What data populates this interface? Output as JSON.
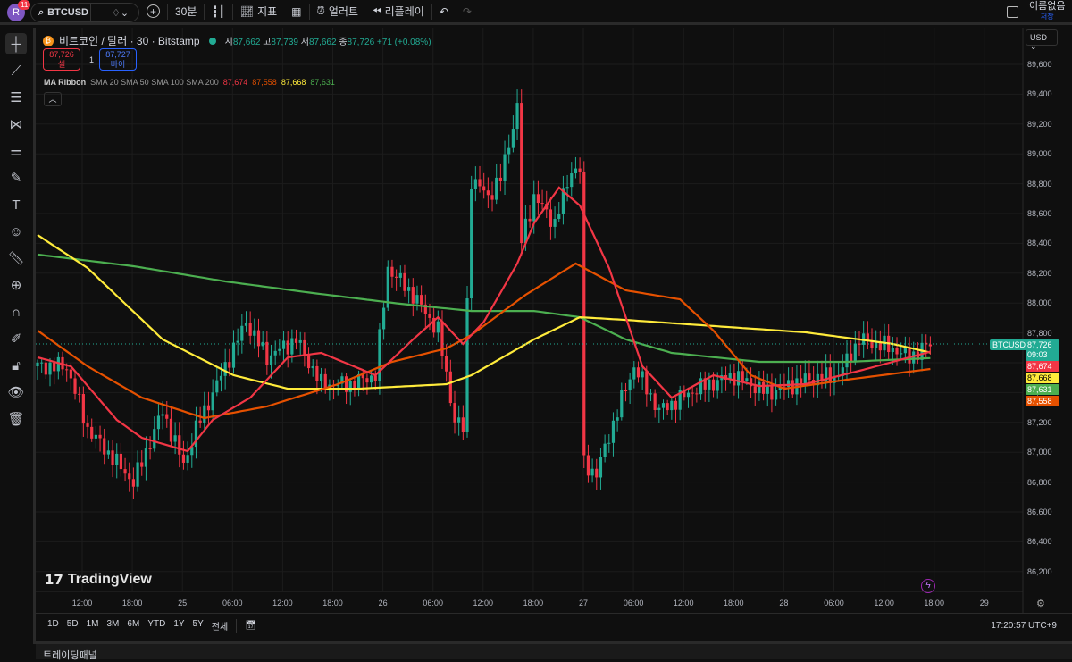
{
  "topbar": {
    "avatar": "R",
    "notifications": "11",
    "symbol": "BTCUSD",
    "interval": "30분",
    "indicators": "지표",
    "alerts": "얼러트",
    "replay": "리플레이",
    "layout_name": "이름없음",
    "save": "저장"
  },
  "legend": {
    "title": "비트코인 / 달러 · 30 · Bitstamp",
    "o_label": "시",
    "o": "87,662",
    "h_label": "고",
    "h": "87,739",
    "l_label": "저",
    "l": "87,662",
    "c_label": "종",
    "c": "87,726",
    "change": "+71 (+0.08%)"
  },
  "trade": {
    "sell_price": "87,726",
    "sell_label": "셀",
    "spread": "1",
    "buy_price": "87,727",
    "buy_label": "바이"
  },
  "ma": {
    "name": "MA Ribbon",
    "params": "SMA 20 SMA 50 SMA 100 SMA 200",
    "v20": "87,674",
    "v50": "87,558",
    "v100": "87,668",
    "v200": "87,631"
  },
  "currency": "USD",
  "price_axis": [
    "89,600",
    "89,400",
    "89,200",
    "89,000",
    "88,800",
    "88,600",
    "88,400",
    "88,200",
    "88,000",
    "87,800",
    "87,600",
    "87,400",
    "87,200",
    "87,000",
    "86,800",
    "86,600",
    "86,400",
    "86,200"
  ],
  "time_axis": [
    "12:00",
    "18:00",
    "25",
    "06:00",
    "12:00",
    "18:00",
    "26",
    "06:00",
    "12:00",
    "18:00",
    "27",
    "06:00",
    "12:00",
    "18:00",
    "28",
    "06:00",
    "12:00",
    "18:00",
    "29"
  ],
  "badges": {
    "symbol": "BTCUSD",
    "last": "87,726",
    "countdown": "09:03",
    "sma20": "87,674",
    "sma100": "87,668",
    "sma200": "87,631",
    "sma50": "87,558"
  },
  "colors": {
    "up": "#22ab94",
    "down": "#f23645",
    "sma20": "#f23645",
    "sma50": "#e65100",
    "sma100": "#ffeb3b",
    "sma200": "#4caf50"
  },
  "watermark": "TradingView",
  "ranges": [
    "1D",
    "5D",
    "1M",
    "3M",
    "6M",
    "YTD",
    "1Y",
    "5Y",
    "전체"
  ],
  "clock": "17:20:57 UTC+9",
  "panel_tab": "트레이딩패널",
  "chart_data": {
    "type": "candlestick",
    "interval": "30m",
    "ylim": [
      86200,
      89600
    ],
    "price_path": [
      [
        0,
        87576
      ],
      [
        7,
        87576
      ],
      [
        12,
        87157
      ],
      [
        23,
        86798
      ],
      [
        30,
        87277
      ],
      [
        35,
        86917
      ],
      [
        38,
        87157
      ],
      [
        45,
        87576
      ],
      [
        50,
        87875
      ],
      [
        55,
        87636
      ],
      [
        62,
        87756
      ],
      [
        68,
        87456
      ],
      [
        75,
        87456
      ],
      [
        81,
        87516
      ],
      [
        84,
        88235
      ],
      [
        90,
        88055
      ],
      [
        96,
        87816
      ],
      [
        100,
        87217
      ],
      [
        102,
        87157
      ],
      [
        104,
        88834
      ],
      [
        108,
        88714
      ],
      [
        111,
        88834
      ],
      [
        115,
        89313
      ],
      [
        116,
        88414
      ],
      [
        119,
        88714
      ],
      [
        124,
        88534
      ],
      [
        128,
        88893
      ],
      [
        130,
        88893
      ],
      [
        131,
        86917
      ],
      [
        134,
        86857
      ],
      [
        139,
        87277
      ],
      [
        143,
        87576
      ],
      [
        149,
        87277
      ],
      [
        158,
        87426
      ],
      [
        167,
        87516
      ],
      [
        175,
        87396
      ],
      [
        184,
        87486
      ],
      [
        192,
        87516
      ],
      [
        197,
        87756
      ],
      [
        205,
        87696
      ],
      [
        209,
        87636
      ],
      [
        214,
        87726
      ]
    ],
    "series": [
      {
        "name": "SMA 200",
        "color": "#4caf50",
        "points": [
          [
            0,
            88325
          ],
          [
            23,
            88247
          ],
          [
            45,
            88145
          ],
          [
            66,
            88067
          ],
          [
            87,
            87995
          ],
          [
            104,
            87947
          ],
          [
            119,
            87947
          ],
          [
            130,
            87905
          ],
          [
            141,
            87756
          ],
          [
            152,
            87666
          ],
          [
            173,
            87606
          ],
          [
            194,
            87606
          ],
          [
            214,
            87631
          ]
        ]
      },
      {
        "name": "SMA 100",
        "color": "#ffeb3b",
        "points": [
          [
            0,
            88456
          ],
          [
            12,
            88235
          ],
          [
            30,
            87756
          ],
          [
            47,
            87516
          ],
          [
            60,
            87426
          ],
          [
            77,
            87426
          ],
          [
            98,
            87456
          ],
          [
            104,
            87516
          ],
          [
            119,
            87756
          ],
          [
            130,
            87905
          ],
          [
            141,
            87887
          ],
          [
            162,
            87846
          ],
          [
            184,
            87804
          ],
          [
            197,
            87756
          ],
          [
            205,
            87726
          ],
          [
            214,
            87668
          ]
        ]
      },
      {
        "name": "SMA 50",
        "color": "#e65100",
        "points": [
          [
            0,
            87816
          ],
          [
            12,
            87576
          ],
          [
            25,
            87366
          ],
          [
            40,
            87229
          ],
          [
            55,
            87307
          ],
          [
            72,
            87456
          ],
          [
            85,
            87606
          ],
          [
            98,
            87696
          ],
          [
            104,
            87786
          ],
          [
            117,
            88055
          ],
          [
            129,
            88265
          ],
          [
            141,
            88085
          ],
          [
            154,
            88025
          ],
          [
            162,
            87816
          ],
          [
            171,
            87516
          ],
          [
            179,
            87426
          ],
          [
            194,
            87486
          ],
          [
            214,
            87558
          ]
        ]
      },
      {
        "name": "SMA 20",
        "color": "#f23645",
        "points": [
          [
            0,
            87636
          ],
          [
            8,
            87576
          ],
          [
            19,
            87217
          ],
          [
            25,
            87097
          ],
          [
            36,
            87007
          ],
          [
            42,
            87217
          ],
          [
            51,
            87366
          ],
          [
            60,
            87636
          ],
          [
            68,
            87666
          ],
          [
            81,
            87516
          ],
          [
            90,
            87756
          ],
          [
            96,
            87905
          ],
          [
            102,
            87726
          ],
          [
            107,
            87875
          ],
          [
            115,
            88265
          ],
          [
            119,
            88534
          ],
          [
            125,
            88774
          ],
          [
            130,
            88654
          ],
          [
            137,
            88235
          ],
          [
            145,
            87576
          ],
          [
            152,
            87366
          ],
          [
            162,
            87516
          ],
          [
            173,
            87444
          ],
          [
            184,
            87456
          ],
          [
            197,
            87546
          ],
          [
            205,
            87606
          ],
          [
            214,
            87674
          ]
        ]
      }
    ]
  }
}
